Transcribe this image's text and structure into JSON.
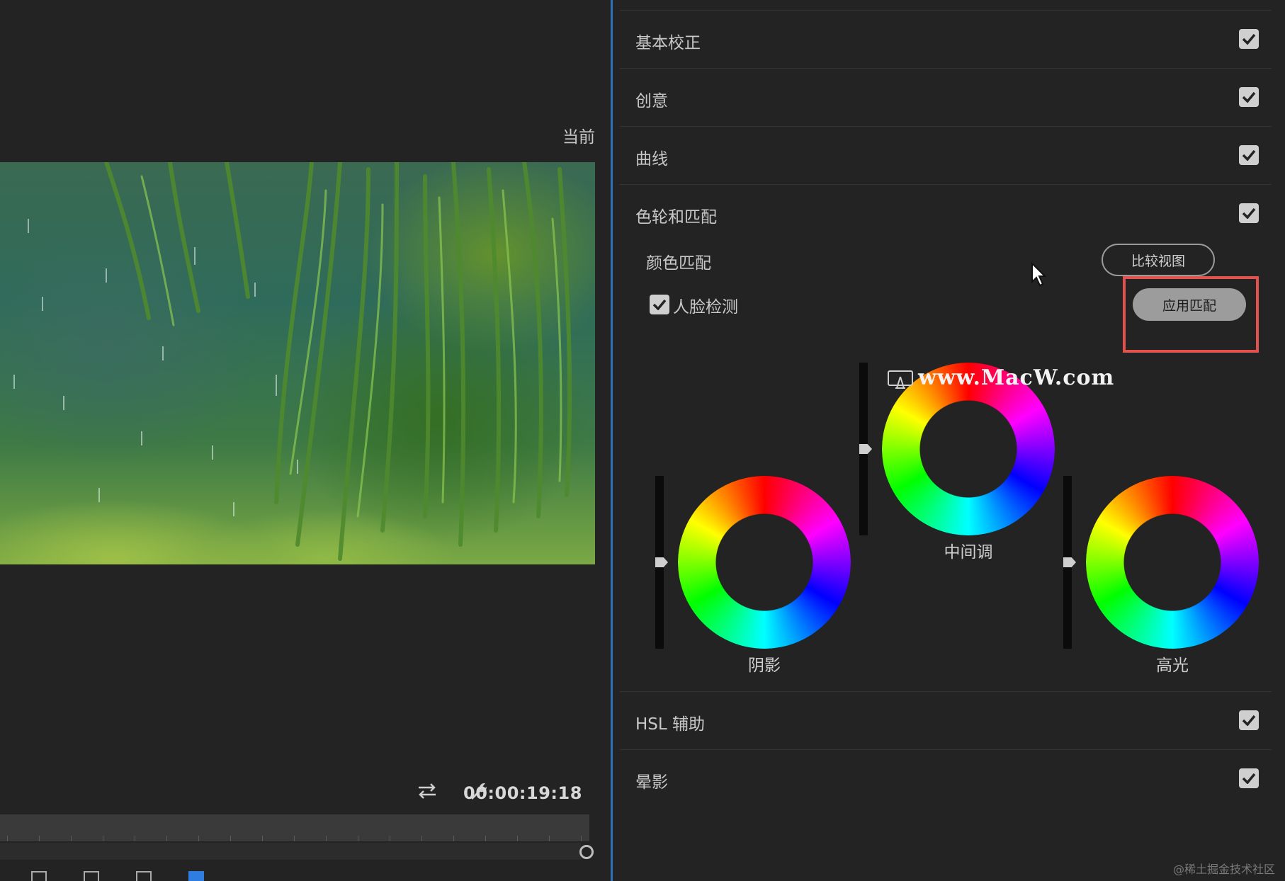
{
  "monitor": {
    "current_label": "当前",
    "timecode": "00:00:19:18"
  },
  "panel": {
    "sections_top": [
      {
        "label": "基本校正",
        "checked": true
      },
      {
        "label": "创意",
        "checked": true
      },
      {
        "label": "曲线",
        "checked": true
      },
      {
        "label": "色轮和匹配",
        "checked": true
      }
    ],
    "color_match_label": "颜色匹配",
    "compare_view_button": "比较视图",
    "apply_match_button": "应用匹配",
    "face_detection_label": "人脸检测",
    "face_detection_checked": true,
    "wheels": {
      "shadows": "阴影",
      "midtones": "中间调",
      "highlights": "高光"
    },
    "sections_bottom": [
      {
        "label": "HSL 辅助",
        "checked": true
      },
      {
        "label": "晕影",
        "checked": true
      }
    ]
  },
  "overlay": {
    "watermark": "www.MacW.com",
    "credit": "@稀土掘金技术社区",
    "highlight_color": "#e2514d"
  },
  "colors": {
    "background": "#232323",
    "splitter": "#2f6fb8"
  },
  "icons": [
    "loop-icon",
    "wrench-icon",
    "checkmark-icon",
    "cursor-icon"
  ]
}
